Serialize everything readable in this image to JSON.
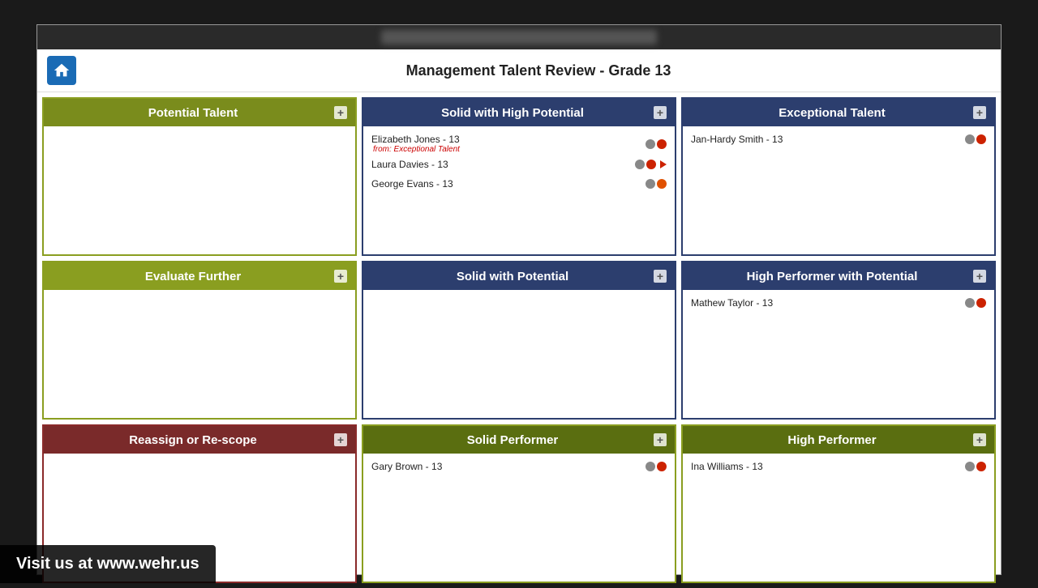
{
  "page": {
    "title": "Management Talent Review - Grade 13",
    "watermark": "Visit us at www.wehr.us"
  },
  "header": {
    "home_label": "Home"
  },
  "grid": {
    "cells": [
      {
        "id": "potential-talent",
        "title": "Potential Talent",
        "header_class": "header-olive",
        "border_class": "cell-border-olive",
        "persons": []
      },
      {
        "id": "solid-high-potential",
        "title": "Solid with High Potential",
        "header_class": "header-navy",
        "border_class": "cell-border-navy",
        "persons": [
          {
            "name": "Elizabeth Jones - 13",
            "note": "from: Exceptional Talent",
            "dots": [
              "gray",
              "red"
            ],
            "arrow": true,
            "secondary": "Laura Davies - 13"
          },
          {
            "name": "George Evans - 13",
            "note": null,
            "dots": [
              "gray",
              "orange"
            ],
            "arrow": false
          }
        ]
      },
      {
        "id": "exceptional-talent",
        "title": "Exceptional Talent",
        "header_class": "header-navy",
        "border_class": "cell-border-navy",
        "persons": [
          {
            "name": "Jan-Hardy Smith - 13",
            "note": null,
            "dots": [
              "gray",
              "red"
            ],
            "arrow": false
          }
        ]
      },
      {
        "id": "evaluate-further",
        "title": "Evaluate Further",
        "header_class": "header-olive-bright",
        "border_class": "cell-border-olive",
        "persons": []
      },
      {
        "id": "solid-with-potential",
        "title": "Solid with Potential",
        "header_class": "header-navy",
        "border_class": "cell-border-navy",
        "persons": []
      },
      {
        "id": "high-performer-potential",
        "title": "High Performer with Potential",
        "header_class": "header-navy",
        "border_class": "cell-border-navy",
        "persons": [
          {
            "name": "Mathew Taylor - 13",
            "note": null,
            "dots": [
              "gray",
              "red"
            ],
            "arrow": false
          }
        ]
      },
      {
        "id": "reassign-rescope",
        "title": "Reassign or Re-scope",
        "header_class": "header-dark-red",
        "border_class": "cell-border-red",
        "persons": []
      },
      {
        "id": "solid-performer",
        "title": "Solid Performer",
        "header_class": "header-olive-green",
        "border_class": "cell-border-olive",
        "persons": [
          {
            "name": "Gary Brown - 13",
            "note": null,
            "dots": [
              "gray",
              "red"
            ],
            "arrow": false
          }
        ]
      },
      {
        "id": "high-performer",
        "title": "High Performer",
        "header_class": "header-olive-green",
        "border_class": "cell-border-olive",
        "persons": [
          {
            "name": "Ina Williams - 13",
            "note": null,
            "dots": [
              "gray",
              "red"
            ],
            "arrow": false
          }
        ]
      }
    ]
  }
}
